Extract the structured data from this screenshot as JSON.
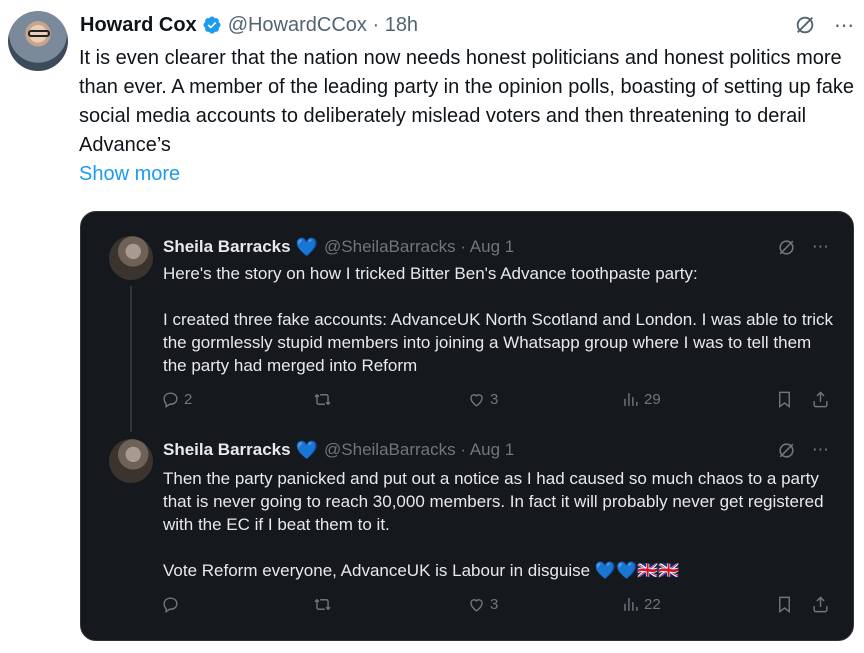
{
  "outer": {
    "name": "Howard Cox",
    "handle_time": "@HowardCCox · 18h",
    "text": "It is even clearer that the nation now needs honest politicians and honest politics more than ever. A member of the leading party in the opinion polls, boasting of setting up fake social media accounts to deliberately mislead voters and then threatening to derail Advance’s",
    "show_more": "Show more",
    "more_icon": "⋯"
  },
  "quoted": [
    {
      "name": "Sheila Barracks",
      "emoji": "💙",
      "handle_time": "@SheilaBarracks · Aug 1",
      "text": "Here's the story on how I tricked Bitter Ben's Advance toothpaste party:\n\nI created three fake accounts: AdvanceUK North Scotland and London. I was able to trick the gormlessly stupid members into joining a Whatsapp group where I was to tell them the party had merged into Reform",
      "replies": "2",
      "likes": "3",
      "views": "29"
    },
    {
      "name": "Sheila Barracks",
      "emoji": "💙",
      "handle_time": "@SheilaBarracks · Aug 1",
      "text": "Then the party panicked and put out a notice as I had caused so much chaos to a party that is never going to reach 30,000 members. In fact it will probably never get registered with the EC if I beat them to it.\n\nVote Reform everyone, AdvanceUK is Labour in disguise 💙💙🇬🇧🇬🇧",
      "replies": "",
      "likes": "3",
      "views": "22"
    }
  ],
  "colors": {
    "link": "#1d9bf0",
    "card_bg": "#15181c",
    "verified": "#1d9bf0"
  }
}
